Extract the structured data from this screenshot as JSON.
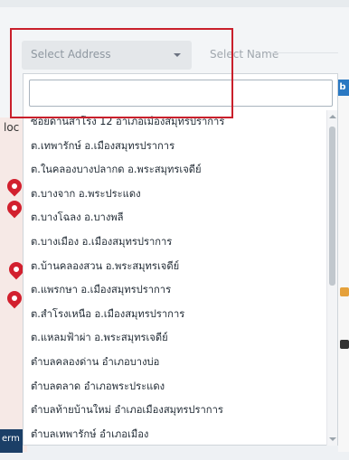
{
  "header": {
    "select_address_placeholder": "Select Address",
    "select_name_placeholder": "Select Name",
    "right_tag": "b"
  },
  "map": {
    "side_label": "loc"
  },
  "dropdown": {
    "search_value": "",
    "items": [
      "ซอยด่านสำโรง 12 อำเภอเมืองสมุทรปราการ",
      "ต.เทพารักษ์ อ.เมืองสมุทรปราการ",
      "ต.ในคลองบางปลากด อ.พระสมุทรเจดีย์",
      "ต.บางจาก อ.พระประแดง",
      "ต.บางโฉลง อ.บางพลี",
      "ต.บางเมือง อ.เมืองสมุทรปราการ",
      "ต.บ้านคลองสวน อ.พระสมุทรเจดีย์",
      "ต.แพรกษา อ.เมืองสมุทรปราการ",
      "ต.สำโรงเหนือ อ.เมืองสมุทรปราการ",
      "ต.แหลมฟ้าผ่า อ.พระสมุทรเจดีย์",
      "ตำบลคลองด่าน อำเภอบางบ่อ",
      "ตำบลตลาด อำเภอพระประแดง",
      "ตำบลท้ายบ้านใหม่ อำเภอเมืองสมุทรปราการ",
      "ตำบลเทพารักษ์ อำเภอเมือง"
    ]
  },
  "footer": {
    "left_text": "erm"
  }
}
